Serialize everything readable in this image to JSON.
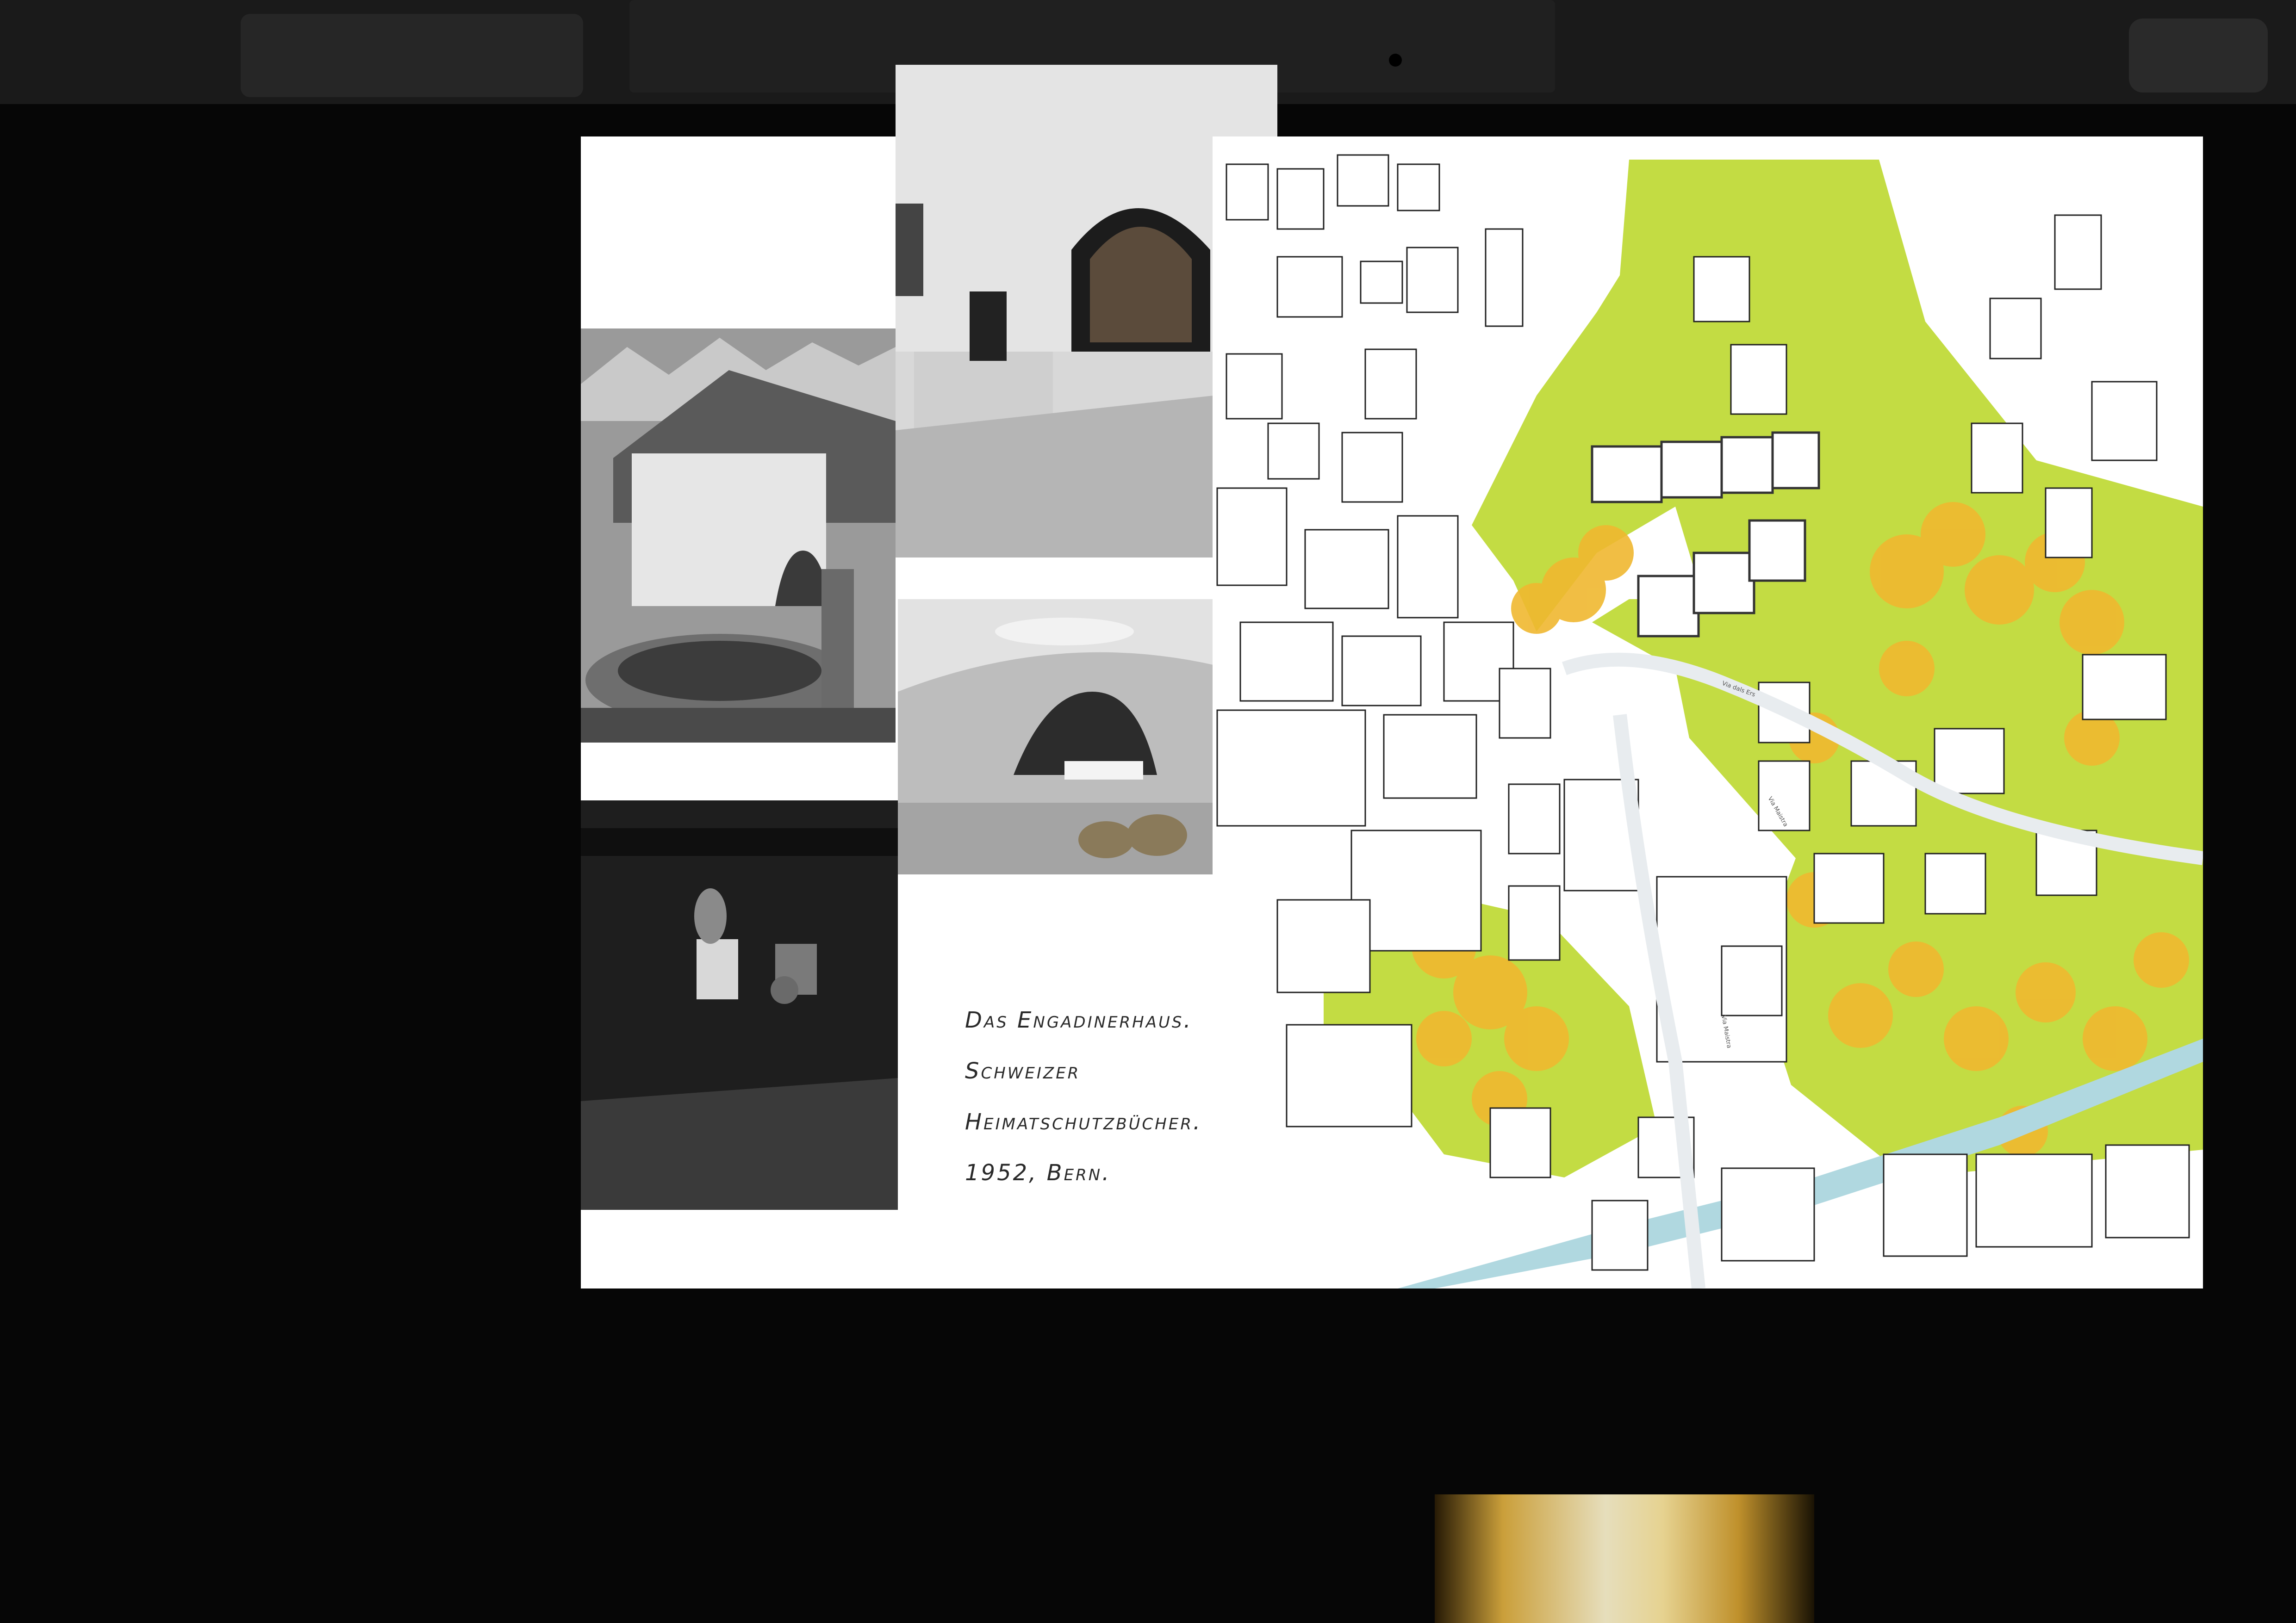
{
  "caption": {
    "lines": [
      "Das Engadinerhaus.",
      "Schweizer",
      "Heimatschutzbücher.",
      "1952, Bern."
    ]
  },
  "map": {
    "colors": {
      "green_space": "#c3dc43",
      "trees": "#f0b830",
      "buildings_outline": "#222222",
      "background": "#ffffff",
      "river": "#b0d8e0"
    },
    "street_labels": [
      "Via dals Ers",
      "Via Maistra",
      "Via Maistra"
    ]
  },
  "photos": [
    {
      "name": "house-with-fountain-photo"
    },
    {
      "name": "arched-doorway-reader-photo"
    },
    {
      "name": "vaulted-interior-family-photo"
    },
    {
      "name": "dark-kitchen-interior-photo"
    }
  ]
}
